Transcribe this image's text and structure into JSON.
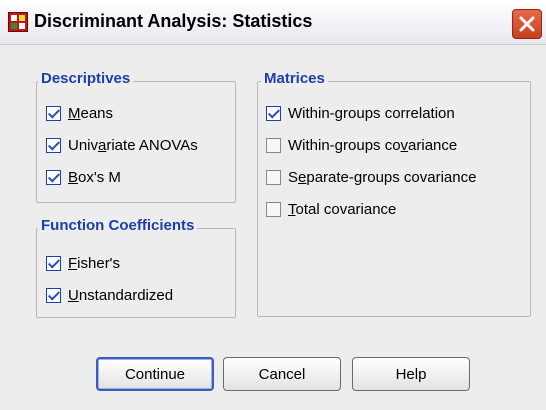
{
  "window": {
    "title": "Discriminant Analysis: Statistics",
    "icon": "spss-app-icon"
  },
  "descriptives": {
    "legend": "Descriptives",
    "items": [
      {
        "pre": "",
        "mnemonic": "M",
        "post": "eans",
        "checked": true
      },
      {
        "pre": "Univ",
        "mnemonic": "a",
        "post": "riate ANOVAs",
        "checked": true
      },
      {
        "pre": "",
        "mnemonic": "B",
        "post": "ox's M",
        "checked": true
      }
    ]
  },
  "function_coefficients": {
    "legend": "Function Coefficients",
    "items": [
      {
        "pre": "",
        "mnemonic": "F",
        "post": "isher's",
        "checked": true
      },
      {
        "pre": "",
        "mnemonic": "U",
        "post": "nstandardized",
        "checked": true
      }
    ]
  },
  "matrices": {
    "legend": "Matrices",
    "items": [
      {
        "pre": "Within-",
        "mnemonic": "g",
        "post": "roups correlation",
        "checked": true
      },
      {
        "pre": "Within-groups co",
        "mnemonic": "v",
        "post": "ariance",
        "checked": false
      },
      {
        "pre": "S",
        "mnemonic": "e",
        "post": "parate-groups covariance",
        "checked": false
      },
      {
        "pre": "",
        "mnemonic": "T",
        "post": "otal covariance",
        "checked": false
      }
    ]
  },
  "buttons": {
    "continue": "Continue",
    "cancel": "Cancel",
    "help": "Help"
  }
}
